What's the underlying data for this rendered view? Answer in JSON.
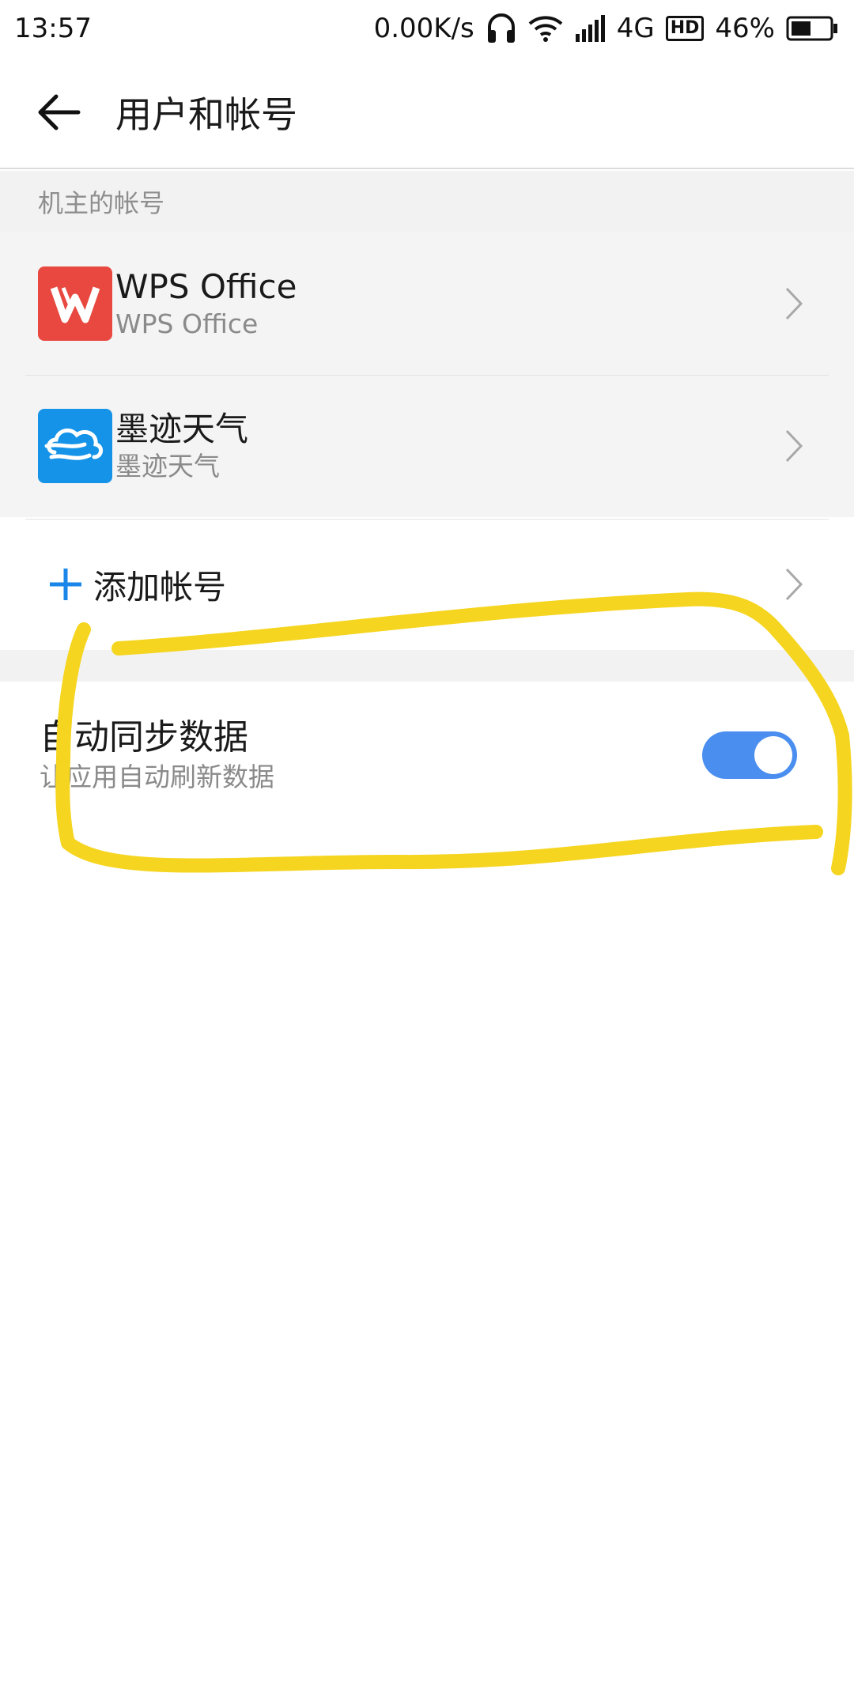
{
  "status_bar": {
    "time": "13:57",
    "net_speed": "0.00K/s",
    "network_type": "4G",
    "hd_badge": "HD",
    "battery": "46%"
  },
  "header": {
    "title": "用户和帐号"
  },
  "owner_accounts": {
    "header": "机主的帐号",
    "items": [
      {
        "title": "WPS Office",
        "subtitle": "WPS Office",
        "icon": "wps-office-icon",
        "color": "#e8483f"
      },
      {
        "title": "墨迹天气",
        "subtitle": "墨迹天气",
        "icon": "moji-weather-icon",
        "color": "#1593e8"
      }
    ]
  },
  "add_account": {
    "label": "添加帐号"
  },
  "auto_sync": {
    "title": "自动同步数据",
    "subtitle": "让应用自动刷新数据",
    "enabled": true
  },
  "colors": {
    "accent": "#4a8ef0",
    "annotation": "#f5d51f"
  }
}
